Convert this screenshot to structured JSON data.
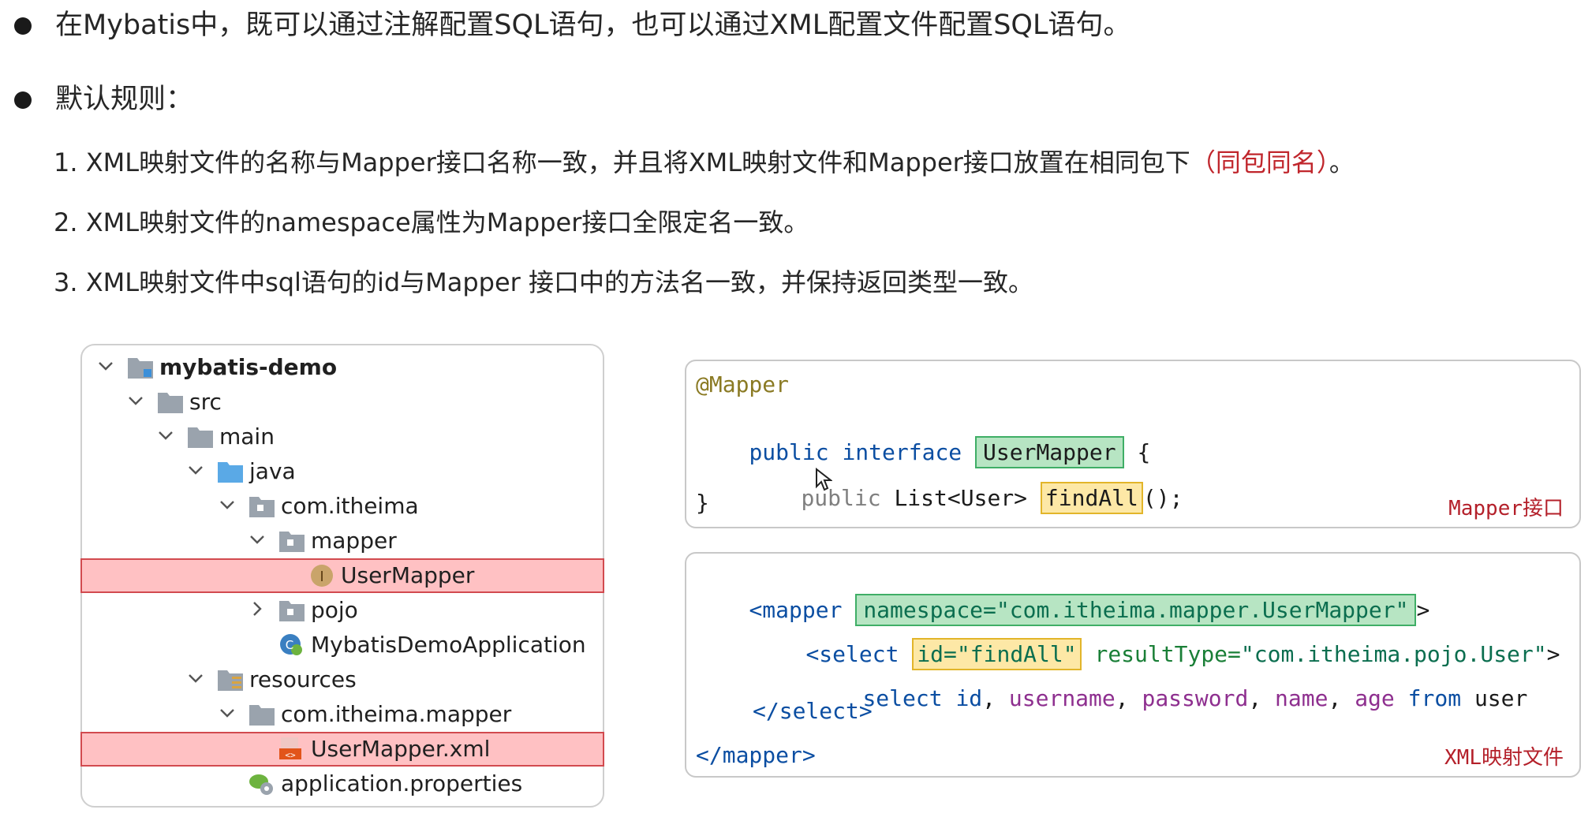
{
  "bullets": [
    "在Mybatis中，既可以通过注解配置SQL语句，也可以通过XML配置文件配置SQL语句。",
    "默认规则："
  ],
  "rules": [
    {
      "num": "1.",
      "text": "XML映射文件的名称与Mapper接口名称一致，并且将XML映射文件和Mapper接口放置在相同包下",
      "highlight": "（同包同名）",
      "tail": "。"
    },
    {
      "num": "2.",
      "text": "XML映射文件的namespace属性为Mapper接口全限定名一致。"
    },
    {
      "num": "3.",
      "text": "XML映射文件中sql语句的id与Mapper 接口中的方法名一致，并保持返回类型一致。"
    }
  ],
  "tree": {
    "items": [
      {
        "label": "mybatis-demo",
        "icon": "module-folder-icon",
        "expanded": true,
        "highlighted": false
      },
      {
        "label": "src",
        "icon": "folder-icon",
        "expanded": true,
        "highlighted": false
      },
      {
        "label": "main",
        "icon": "folder-icon",
        "expanded": true,
        "highlighted": false
      },
      {
        "label": "java",
        "icon": "source-folder-icon",
        "expanded": true,
        "highlighted": false
      },
      {
        "label": "com.itheima",
        "icon": "package-icon",
        "expanded": true,
        "highlighted": false
      },
      {
        "label": "mapper",
        "icon": "package-icon",
        "expanded": true,
        "highlighted": false
      },
      {
        "label": "UserMapper",
        "icon": "interface-icon",
        "highlighted": true
      },
      {
        "label": "pojo",
        "icon": "package-icon",
        "expanded": false,
        "highlighted": false
      },
      {
        "label": "MybatisDemoApplication",
        "icon": "spring-class-icon",
        "highlighted": false
      },
      {
        "label": "resources",
        "icon": "resources-folder-icon",
        "expanded": true,
        "highlighted": false
      },
      {
        "label": "com.itheima.mapper",
        "icon": "folder-icon",
        "expanded": true,
        "highlighted": false
      },
      {
        "label": "UserMapper.xml",
        "icon": "xml-file-icon",
        "highlighted": true
      },
      {
        "label": "application.properties",
        "icon": "properties-file-icon",
        "highlighted": false
      }
    ]
  },
  "java_code": {
    "annotation": "@Mapper",
    "line2_kw": "public interface",
    "class_name": "UserMapper",
    "brace_open": "{",
    "method_kw": "public",
    "return_type": "List<User>",
    "method_name": "findAll",
    "method_tail": "();",
    "brace_close": "}",
    "caption": "Mapper接口"
  },
  "xml_code": {
    "open_tag": "<mapper",
    "namespace_attr": "namespace=\"com.itheima.mapper.UserMapper\"",
    "gt": ">",
    "select_open": "<select",
    "id_attr": "id=\"findAll\"",
    "result_key": "resultType=",
    "result_val": "\"com.itheima.pojo.User\"",
    "select_gt": ">",
    "sql_select": "select",
    "sql_id": "id",
    "sql_username": "username",
    "sql_password": "password",
    "sql_name": "name",
    "sql_age": "age",
    "sql_from": "from",
    "sql_table": "user",
    "comma": ",",
    "select_close": "</select>",
    "mapper_close": "</mapper>",
    "caption": "XML映射文件"
  },
  "colors": {
    "highlight_red": "#ffc1c3",
    "highlight_green": "#b7e5c3",
    "highlight_yellow": "#fde8a6",
    "keyword_blue": "#0b4ea2",
    "caption_red": "#b4202a"
  }
}
